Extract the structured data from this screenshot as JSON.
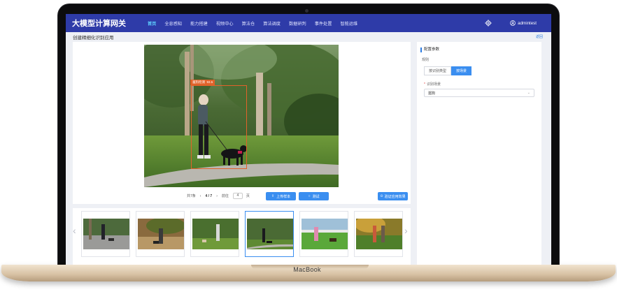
{
  "app": {
    "title": "大模型计算网关"
  },
  "nav": {
    "items": [
      {
        "label": "首页",
        "active": true
      },
      {
        "label": "全息感知",
        "active": false
      },
      {
        "label": "能力搭建",
        "active": false
      },
      {
        "label": "视频中心",
        "active": false
      },
      {
        "label": "算法仓",
        "active": false
      },
      {
        "label": "算法调度",
        "active": false
      },
      {
        "label": "数据研判",
        "active": false
      },
      {
        "label": "事件处置",
        "active": false
      },
      {
        "label": "智能运维",
        "active": false
      }
    ],
    "user": "admintest"
  },
  "page": {
    "title": "创建精细化识别应用",
    "back_label": "返回"
  },
  "detection": {
    "label": "遛狗检测",
    "score": "93.5"
  },
  "pager": {
    "total_label": "共7条",
    "current": "4 / 7",
    "goto_label": "前往",
    "page_value": "4",
    "page_unit": "页"
  },
  "buttons": {
    "upload": "上传样本",
    "test": "测试",
    "verify": "验证应用效果"
  },
  "config": {
    "title": "配置参数",
    "rule_label": "规则",
    "tabs": [
      {
        "label": "按识别类型",
        "active": false
      },
      {
        "label": "按场景",
        "active": true
      }
    ],
    "field_label": "识别场景",
    "field_value": "遛狗"
  },
  "brand": "MacBook",
  "colors": {
    "nav_bg": "#2e3ba8",
    "accent": "#3a8ef0",
    "detect": "#e0622a"
  },
  "thumbnails": [
    {
      "name": "thumb-1",
      "selected": false
    },
    {
      "name": "thumb-2",
      "selected": false
    },
    {
      "name": "thumb-3",
      "selected": false
    },
    {
      "name": "thumb-4",
      "selected": true
    },
    {
      "name": "thumb-5",
      "selected": false
    },
    {
      "name": "thumb-6",
      "selected": false
    }
  ]
}
